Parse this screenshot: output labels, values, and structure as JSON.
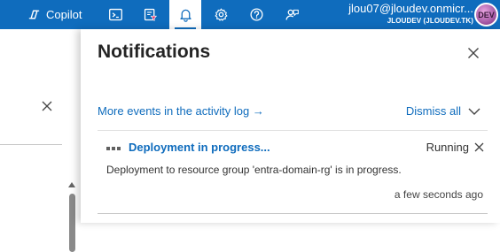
{
  "topbar": {
    "copilot_label": "Copilot",
    "icons": [
      "cloud-shell-icon",
      "directory-filter-icon",
      "notifications-bell-icon",
      "settings-gear-icon",
      "help-icon",
      "feedback-icon"
    ],
    "user_email": "jlou07@jloudev.onmicr...",
    "tenant": "JLOUDEV (JLOUDEV.TK)",
    "avatar_text": "DEV"
  },
  "notifications": {
    "title": "Notifications",
    "more_events_link": "More events in the activity log",
    "more_events_arrow": "→",
    "dismiss_all": "Dismiss all",
    "items": [
      {
        "title": "Deployment in progress...",
        "status": "Running",
        "message": "Deployment to resource group 'entra-domain-rg' is in progress.",
        "time": "a few seconds ago"
      }
    ]
  },
  "colors": {
    "brand": "#0f6cbd",
    "text": "#242424"
  }
}
